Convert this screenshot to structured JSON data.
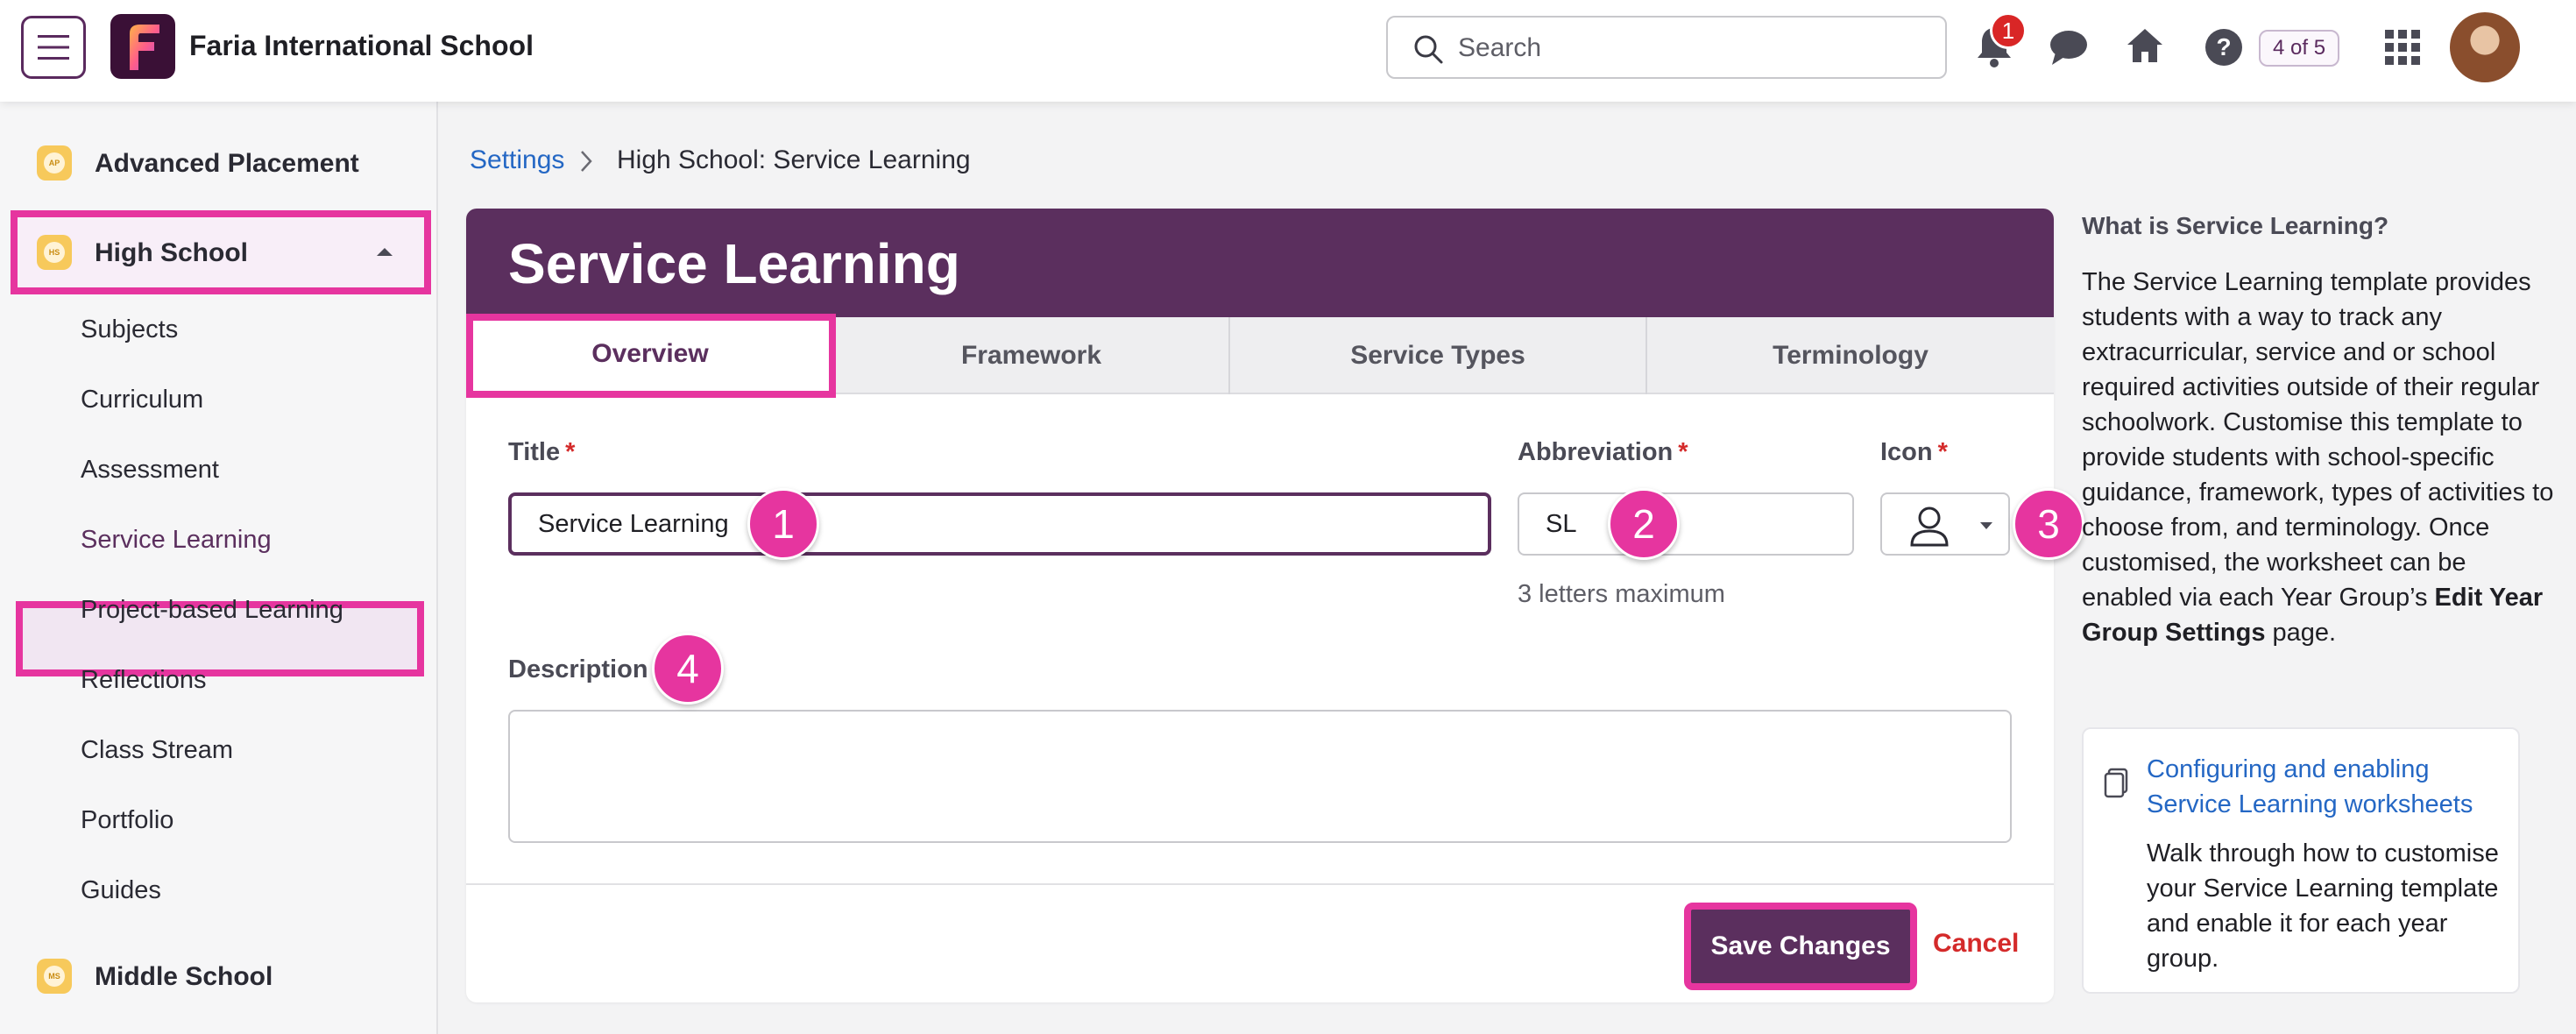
{
  "topbar": {
    "school_name": "Faria International School",
    "search_placeholder": "Search",
    "notification_count": "1",
    "progress_counter": "4 of 5",
    "logo_letter": "F"
  },
  "sidebar": {
    "groups": [
      {
        "label": "Advanced Placement",
        "icon_text": "AP"
      },
      {
        "label": "High School",
        "icon_text": "HS"
      },
      {
        "label": "Middle School",
        "icon_text": "MS"
      }
    ],
    "items": [
      "Subjects",
      "Curriculum",
      "Assessment",
      "Service Learning",
      "Project-based Learning",
      "Reflections",
      "Class Stream",
      "Portfolio",
      "Guides"
    ]
  },
  "breadcrumb": {
    "link": "Settings",
    "current": "High School: Service Learning"
  },
  "card": {
    "title": "Service Learning",
    "tabs": [
      "Overview",
      "Framework",
      "Service Types",
      "Terminology"
    ]
  },
  "form": {
    "title_label": "Title",
    "title_value": "Service Learning",
    "abbr_label": "Abbreviation",
    "abbr_value": "SL",
    "abbr_hint": "3 letters maximum",
    "icon_label": "Icon",
    "description_label": "Description",
    "required_mark": "*",
    "save_label": "Save Changes",
    "cancel_label": "Cancel"
  },
  "markers": [
    "1",
    "2",
    "3",
    "4"
  ],
  "help": {
    "title": "What is Service Learning?",
    "text_before": "The Service Learning template provides students with a way to track any extracurricular, service and or school required activities outside of their regular schoolwork. Customise this template to provide students with school-specific guidance, framework, types of activities to choose from, and terminology. Once customised, the worksheet can be enabled via each Year Group’s ",
    "text_bold": "Edit Year Group Settings",
    "text_after": " page.",
    "card_link": "Configuring and enabling Service Learning worksheets",
    "card_text": "Walk through how to customise your Service Learning template and enable it for each year group."
  },
  "colors": {
    "brand_purple": "#5b2f5e",
    "highlight_pink": "#e6359f",
    "link_blue": "#2467c4",
    "required_red": "#d42a2a"
  }
}
